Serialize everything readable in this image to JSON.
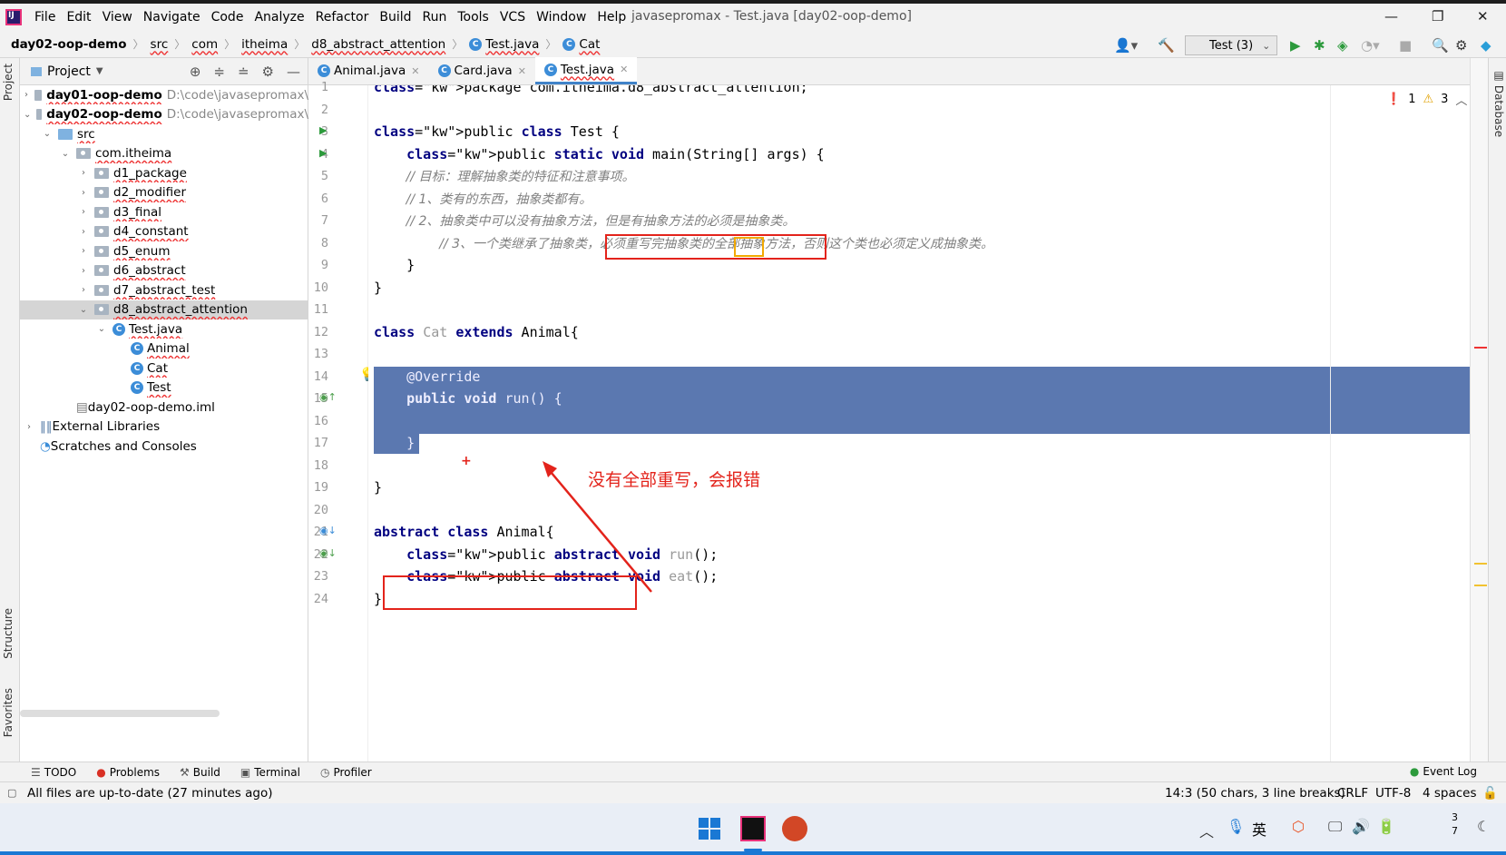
{
  "menubar": {
    "items": [
      "File",
      "Edit",
      "View",
      "Navigate",
      "Code",
      "Analyze",
      "Refactor",
      "Build",
      "Run",
      "Tools",
      "VCS",
      "Window",
      "Help"
    ],
    "window_title": "javasepromax - Test.java [day02-oop-demo]"
  },
  "breadcrumb": [
    "day02-oop-demo",
    "src",
    "com",
    "itheima",
    "d8_abstract_attention",
    "Test.java",
    "Cat"
  ],
  "toolbar": {
    "run_config": "Test (3)"
  },
  "project_panel": {
    "title": "Project",
    "tree": [
      {
        "label": "day01-oop-demo",
        "path": "D:\\code\\javasepromax\\",
        "bold": true,
        "level": 0,
        "kind": "module",
        "open": false
      },
      {
        "label": "day02-oop-demo",
        "path": "D:\\code\\javasepromax\\",
        "bold": true,
        "level": 0,
        "kind": "module",
        "open": true
      },
      {
        "label": "src",
        "level": 1,
        "kind": "src",
        "open": true
      },
      {
        "label": "com.itheima",
        "level": 2,
        "kind": "package",
        "open": true
      },
      {
        "label": "d1_package",
        "level": 3,
        "kind": "package",
        "open": false
      },
      {
        "label": "d2_modifier",
        "level": 3,
        "kind": "package",
        "open": false
      },
      {
        "label": "d3_final",
        "level": 3,
        "kind": "package",
        "open": false
      },
      {
        "label": "d4_constant",
        "level": 3,
        "kind": "package",
        "open": false
      },
      {
        "label": "d5_enum",
        "level": 3,
        "kind": "package",
        "open": false
      },
      {
        "label": "d6_abstract",
        "level": 3,
        "kind": "package",
        "open": false
      },
      {
        "label": "d7_abstract_test",
        "level": 3,
        "kind": "package",
        "open": false
      },
      {
        "label": "d8_abstract_attention",
        "level": 3,
        "kind": "package",
        "open": true,
        "selected": true
      },
      {
        "label": "Test.java",
        "level": 4,
        "kind": "javafile",
        "open": true
      },
      {
        "label": "Animal",
        "level": 5,
        "kind": "class"
      },
      {
        "label": "Cat",
        "level": 5,
        "kind": "class"
      },
      {
        "label": "Test",
        "level": 5,
        "kind": "class"
      },
      {
        "label": "day02-oop-demo.iml",
        "level": 2,
        "kind": "iml"
      },
      {
        "label": "External Libraries",
        "level": 0,
        "kind": "libs",
        "open": false
      },
      {
        "label": "Scratches and Consoles",
        "level": 0,
        "kind": "scratch"
      }
    ]
  },
  "side_labels": {
    "left_top": "Project",
    "left_mid": "Structure",
    "left_bottom": "Favorites",
    "right": "Database"
  },
  "editor_tabs": [
    {
      "label": "Animal.java",
      "active": false
    },
    {
      "label": "Card.java",
      "active": false
    },
    {
      "label": "Test.java",
      "active": true
    }
  ],
  "inspections": {
    "errors": "1",
    "warnings": "3"
  },
  "code_lines": [
    {
      "n": "1",
      "text": "package com.itheima.d8_abstract_attention;"
    },
    {
      "n": "2",
      "text": ""
    },
    {
      "n": "3",
      "text": "public class Test {"
    },
    {
      "n": "4",
      "text": "    public static void main(String[] args) {"
    },
    {
      "n": "5",
      "text": "        // 目标：理解抽象类的特征和注意事项。"
    },
    {
      "n": "6",
      "text": "        // 1、类有的东西，抽象类都有。"
    },
    {
      "n": "7",
      "text": "        // 2、抽象类中可以没有抽象方法，但是有抽象方法的必须是抽象类。"
    },
    {
      "n": "8",
      "text": "        // 3、一个类继承了抽象类，必须重写完抽象类的全部抽象方法，否则这个类也必须定义成抽象类。"
    },
    {
      "n": "9",
      "text": "    }"
    },
    {
      "n": "10",
      "text": "}"
    },
    {
      "n": "11",
      "text": ""
    },
    {
      "n": "12",
      "text": "class Cat extends Animal{"
    },
    {
      "n": "13",
      "text": ""
    },
    {
      "n": "14",
      "text": "    @Override"
    },
    {
      "n": "15",
      "text": "    public void run() {"
    },
    {
      "n": "16",
      "text": ""
    },
    {
      "n": "17",
      "text": "    }"
    },
    {
      "n": "18",
      "text": ""
    },
    {
      "n": "19",
      "text": "}"
    },
    {
      "n": "20",
      "text": ""
    },
    {
      "n": "21",
      "text": "abstract class Animal{"
    },
    {
      "n": "22",
      "text": "    public abstract void run();"
    },
    {
      "n": "23",
      "text": "    public abstract void eat();"
    },
    {
      "n": "24",
      "text": "}"
    }
  ],
  "comment8": {
    "prefix": "// 3、一个类继承了抽象类，",
    "boxed_a": "必须重写完抽象类的",
    "boxed_b": "全部",
    "boxed_c": "抽象方法，",
    "suffix": "否则这个类也必须定义成抽象类。"
  },
  "annotation": "没有全部重写，会报错",
  "tool_windows": [
    "TODO",
    "Problems",
    "Build",
    "Terminal",
    "Profiler"
  ],
  "event_log": "Event Log",
  "status": {
    "message": "All files are up-to-date (27 minutes ago)",
    "position": "14:3 (50 chars, 3 line breaks)",
    "line_sep": "CRLF",
    "encoding": "UTF-8",
    "indent": "4 spaces"
  },
  "taskbar": {
    "clock_top": "3",
    "clock_bottom": "7",
    "ime": "英"
  },
  "colors": {
    "selection": "#5b78b0",
    "keyword": "#000080",
    "comment": "#808080",
    "annotation_red": "#e3231b",
    "highlight_orange": "#f2a900"
  }
}
